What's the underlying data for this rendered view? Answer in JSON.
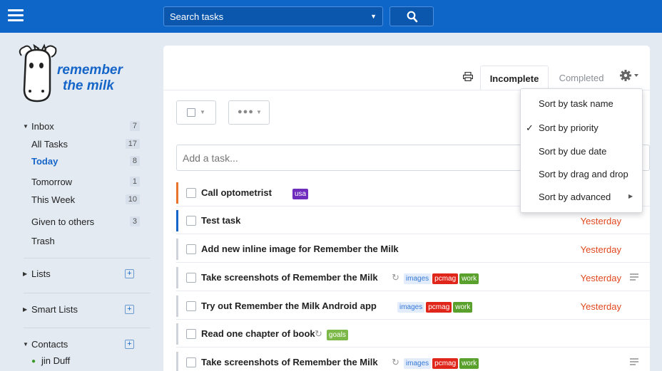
{
  "app": {
    "logo_text_1": "remember",
    "logo_text_2": "the milk"
  },
  "topbar": {
    "search_placeholder": "Search tasks",
    "menu_icon": "hamburger-icon",
    "search_icon": "magnifier-icon"
  },
  "sidebar": {
    "items": [
      {
        "label": "Inbox",
        "count": "7"
      },
      {
        "label": "All Tasks",
        "count": "17"
      },
      {
        "label": "Today",
        "count": "8"
      },
      {
        "label": "Tomorrow",
        "count": "1"
      },
      {
        "label": "This Week",
        "count": "10"
      },
      {
        "label": "Given to others",
        "count": "3"
      },
      {
        "label": "Trash",
        "count": ""
      }
    ],
    "sections": [
      {
        "label": "Lists"
      },
      {
        "label": "Smart Lists"
      },
      {
        "label": "Contacts"
      }
    ],
    "contact": {
      "name": "jin Duff"
    }
  },
  "main": {
    "tabs": {
      "incomplete": "Incomplete",
      "completed": "Completed"
    },
    "add_task_placeholder": "Add a task...",
    "more_dots": "●●●"
  },
  "menu": {
    "items": [
      {
        "label": "Sort by task name"
      },
      {
        "label": "Sort by priority",
        "checked": true
      },
      {
        "label": "Sort by due date"
      },
      {
        "label": "Sort by drag and drop"
      },
      {
        "label": "Sort by advanced",
        "submenu": true
      }
    ]
  },
  "tasks": [
    {
      "name": "Call optometrist",
      "tags": [
        "usa"
      ],
      "due": "",
      "priority_color": "#e8732a"
    },
    {
      "name": "Test task",
      "tags": [],
      "due": "Yesterday",
      "priority_color": "#1565c8"
    },
    {
      "name": "Add new inline image for Remember the Milk",
      "tags": [],
      "due": "Yesterday",
      "priority_color": "#cfd4da"
    },
    {
      "name": "Take screenshots of Remember the Milk",
      "tags": [
        "images",
        "pcmag",
        "work"
      ],
      "due": "Yesterday",
      "priority_color": "#cfd4da",
      "repeat": true,
      "note": true
    },
    {
      "name": "Try out Remember the Milk Android app",
      "tags": [
        "images",
        "pcmag",
        "work"
      ],
      "due": "Yesterday",
      "priority_color": "#cfd4da"
    },
    {
      "name": "Read one chapter of book",
      "tags": [
        "goals"
      ],
      "due": "",
      "priority_color": "#cfd4da",
      "repeat": true
    },
    {
      "name": "Take screenshots of Remember the Milk",
      "tags": [
        "images",
        "pcmag",
        "work"
      ],
      "due": "",
      "priority_color": "#cfd4da",
      "repeat": true,
      "note": true
    }
  ],
  "colors": {
    "topbar": "#0f66c9",
    "sidebar_bg": "#e3eaf2",
    "due_overdue": "#e0471f",
    "today_link": "#1565c8"
  }
}
